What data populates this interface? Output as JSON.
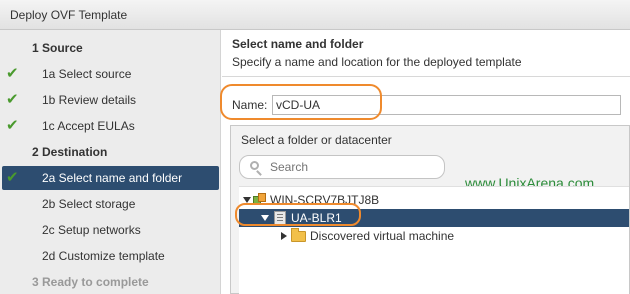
{
  "window": {
    "title": "Deploy OVF Template"
  },
  "wizard": {
    "steps": [
      {
        "label": "1  Source",
        "kind": "header",
        "checked": false
      },
      {
        "label": "1a  Select source",
        "kind": "sub",
        "checked": true
      },
      {
        "label": "1b  Review details",
        "kind": "sub",
        "checked": true
      },
      {
        "label": "1c  Accept EULAs",
        "kind": "sub",
        "checked": true
      },
      {
        "label": "2  Destination",
        "kind": "header",
        "checked": false
      },
      {
        "label": "2a  Select name and folder",
        "kind": "sub",
        "checked": true,
        "active": true
      },
      {
        "label": "2b  Select storage",
        "kind": "sub",
        "checked": false
      },
      {
        "label": "2c  Setup networks",
        "kind": "sub",
        "checked": false
      },
      {
        "label": "2d  Customize template",
        "kind": "sub",
        "checked": false
      },
      {
        "label": "3  Ready to complete",
        "kind": "header",
        "checked": false,
        "disabled": true
      }
    ]
  },
  "pane": {
    "title": "Select name and folder",
    "subtitle": "Specify a name and location for the deployed template",
    "name_label": "Name:",
    "name_value": "vCD-UA",
    "folder_hint": "Select a folder or datacenter",
    "search_placeholder": "Search",
    "watermark": "www.UnixArena.com"
  },
  "tree": {
    "root": "WIN-SCRV7BJTJ8B",
    "datacenter": "UA-BLR1",
    "folder": "Discovered virtual machine"
  },
  "colors": {
    "selection": "#2d4d70",
    "check": "#4a9a2e",
    "highlight_outline": "#ef8a2d",
    "watermark": "#2c8c3a"
  }
}
